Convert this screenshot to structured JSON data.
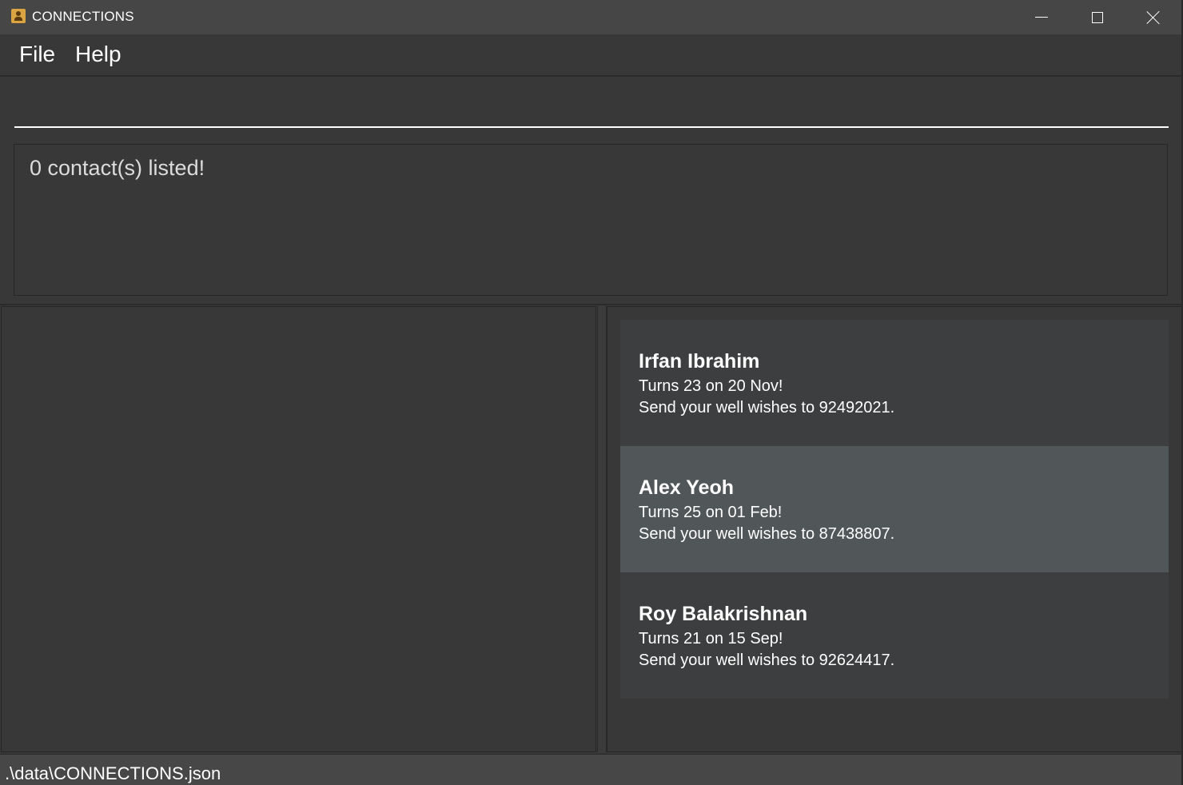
{
  "window": {
    "title": "CONNECTIONS",
    "app_icon": "address-book-icon",
    "controls": [
      "minimize-icon",
      "maximize-icon",
      "close-icon"
    ]
  },
  "menu": {
    "items": [
      {
        "label": "File"
      },
      {
        "label": "Help"
      }
    ]
  },
  "command": {
    "value": "",
    "placeholder": ""
  },
  "result": {
    "message": "0 contact(s) listed!"
  },
  "birthdays": {
    "selected_index": 1,
    "items": [
      {
        "name": "Irfan Ibrahim",
        "turns": "Turns 23 on 20 Nov!",
        "wishes": "Send your well wishes to 92492021."
      },
      {
        "name": "Alex Yeoh",
        "turns": "Turns 25 on 01 Feb!",
        "wishes": "Send your well wishes to 87438807."
      },
      {
        "name": "Roy Balakrishnan",
        "turns": "Turns 21 on 15 Sep!",
        "wishes": "Send your well wishes to 92624417."
      }
    ]
  },
  "status": {
    "path": ".\\data\\CONNECTIONS.json"
  },
  "colors": {
    "background": "#383838",
    "titlebar": "#464646",
    "card": "#3c3e3f",
    "card_selected": "#515658",
    "text": "#ffffff"
  }
}
